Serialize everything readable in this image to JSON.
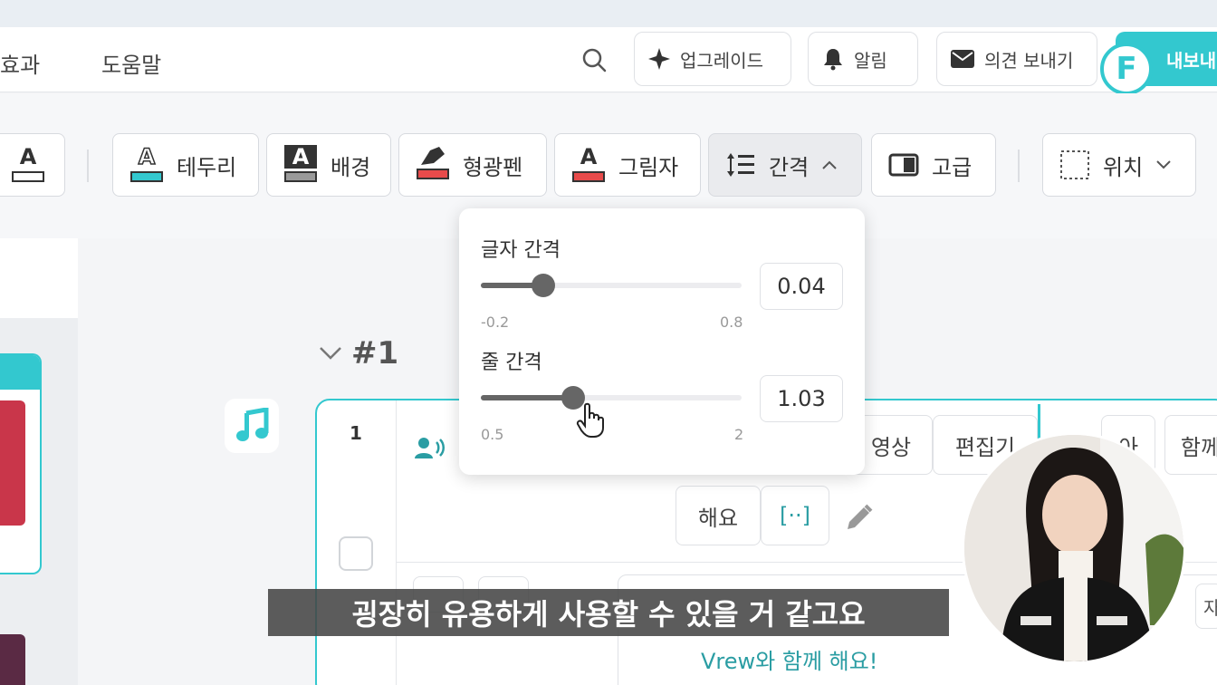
{
  "topbar": {
    "menu": [
      {
        "label": "효과"
      },
      {
        "label": "도움말"
      }
    ],
    "buttons": {
      "upgrade": "업그레이드",
      "notifications": "알림",
      "feedback": "의견 보내기",
      "export": "내보내"
    },
    "export_logo": "F"
  },
  "toolbar": {
    "text_color_glyph": "A",
    "buttons": {
      "outline": "테두리",
      "background": "배경",
      "highlighter": "형광펜",
      "shadow": "그림자",
      "spacing": "간격",
      "advanced": "고급",
      "position": "위치"
    },
    "glyph_letter": "A"
  },
  "spacing_popover": {
    "letter_spacing": {
      "label": "글자 간격",
      "value": "0.04",
      "min": "-0.2",
      "max": "0.8",
      "fraction": 0.24
    },
    "line_spacing": {
      "label": "줄 간격",
      "value": "1.03",
      "min": "0.5",
      "max": "2",
      "fraction": 0.353
    }
  },
  "clip": {
    "section_label": "#1",
    "number": "1",
    "words": [
      "영상",
      "편집기",
      "아",
      "함께",
      "해요",
      "[··]"
    ],
    "subtitle_partial": "Vrew와 함께 해요!",
    "side_char": "자"
  },
  "caption": "굉장히 유용하게 사용할 수 있을 거 같고요",
  "colors": {
    "accent": "#33c8cf",
    "outline_swatch": "#33c8cf",
    "background_swatch": "#9a9a9a",
    "highlighter_swatch": "#e84b4b",
    "shadow_swatch": "#e84b4b"
  }
}
